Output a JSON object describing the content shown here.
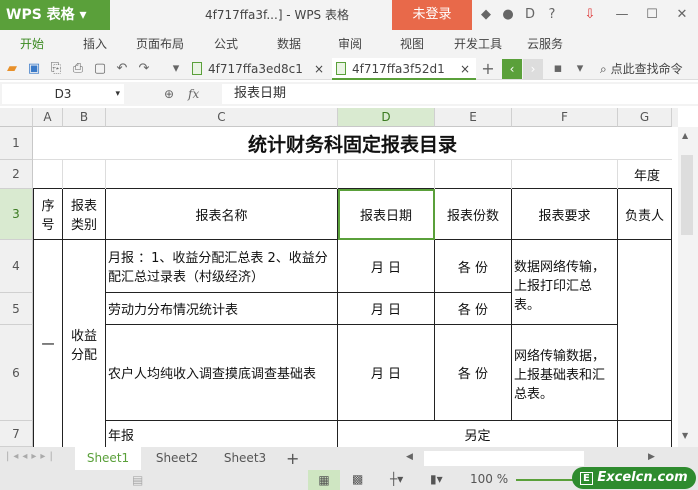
{
  "app": {
    "logo": "WPS 表格",
    "doc_title": "4f717ffa3f...] - WPS 表格",
    "login": "未登录"
  },
  "menu": [
    "开始",
    "插入",
    "页面布局",
    "公式",
    "数据",
    "审阅",
    "视图",
    "开发工具",
    "云服务"
  ],
  "tabs": [
    {
      "label": "4f717ffa3ed8c1"
    },
    {
      "label": "4f717ffa3f52d1"
    }
  ],
  "search": "点此查找命令",
  "formula": {
    "cell": "D3",
    "fx": "fx",
    "value": "报表日期"
  },
  "columns": [
    "A",
    "B",
    "C",
    "D",
    "E",
    "F",
    "G"
  ],
  "rows": [
    "1",
    "2",
    "3",
    "4",
    "5",
    "6",
    "7"
  ],
  "sheet": {
    "title": "统计财务科固定报表目录",
    "year": "年度",
    "headers": [
      "序号",
      "报表类别",
      "报表名称",
      "报表日期",
      "报表份数",
      "报表要求",
      "负责人"
    ],
    "seq": "一",
    "category": "收益分配",
    "r4": {
      "name": "月报 ：1、收益分配汇总表 2、收益分配汇总过录表（村级经济）",
      "date": "月 日",
      "count": "各 份",
      "req": "数据网络传输，上报打印汇总表。"
    },
    "r5": {
      "name": "劳动力分布情况统计表",
      "date": "月 日",
      "count": "各 份"
    },
    "r6": {
      "name": "农户人均纯收入调查摸底调查基础表",
      "date": "月 日",
      "count": "各 份",
      "req": "网络传输数据，上报基础表和汇总表。"
    },
    "r7": {
      "name": "年报",
      "other": "另定"
    }
  },
  "sheets": [
    "Sheet1",
    "Sheet2",
    "Sheet3"
  ],
  "status": {
    "zoom": "100 %",
    "watermark": "Excelcn.com"
  }
}
